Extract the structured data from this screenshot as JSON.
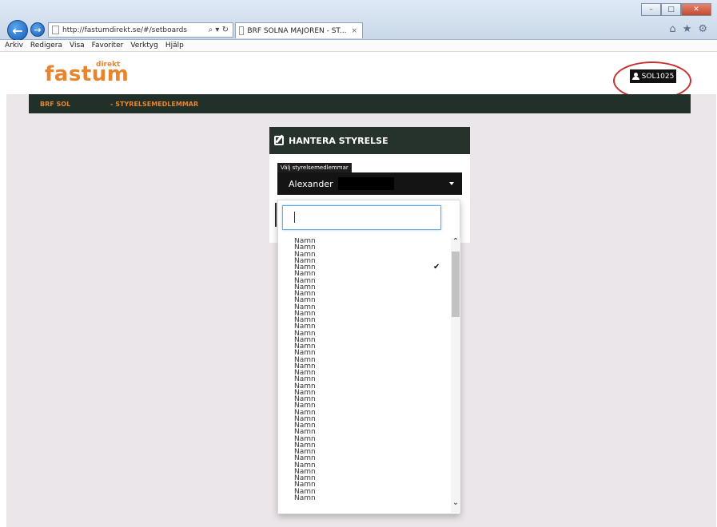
{
  "browser": {
    "url": "http://fastumdirekt.se/#/setboards",
    "tab_title": "BRF SOLNA MAJOREN - ST...",
    "tab_close": "×",
    "addr_tools": "⌕ ▾ ↻",
    "menu": [
      "Arkiv",
      "Redigera",
      "Visa",
      "Favoriter",
      "Verktyg",
      "Hjälp"
    ],
    "window_buttons": {
      "min": "–",
      "max": "□",
      "close": "✕"
    },
    "icons": {
      "home": "⌂",
      "star": "★",
      "gear": "⚙"
    }
  },
  "header": {
    "logo_text": "fastum",
    "logo_sup": "direkt",
    "user": "SOL1025"
  },
  "nav": {
    "brf": "BRF SOL",
    "section": "- STYRELSEMEDLEMMAR"
  },
  "card": {
    "title": "HANTERA STYRELSE",
    "field_label": "Välj styrelsemedlemmar",
    "selected": "Alexander"
  },
  "dropdown": {
    "search_value": "",
    "options": [
      "Namn",
      "Namn",
      "Namn",
      "Namn",
      "Namn",
      "Namn",
      "Namn",
      "Namn",
      "Namn",
      "Namn",
      "Namn",
      "Namn",
      "Namn",
      "Namn",
      "Namn",
      "Namn",
      "Namn",
      "Namn",
      "Namn",
      "Namn",
      "Namn",
      "Namn",
      "Namn",
      "Namn",
      "Namn",
      "Namn",
      "Namn",
      "Namn",
      "Namn",
      "Namn",
      "Namn",
      "Namn",
      "Namn",
      "Namn",
      "Namn",
      "Namn",
      "Namn",
      "Namn",
      "Namn",
      "Namn"
    ],
    "checked_index": 4,
    "check_glyph": "✔",
    "scroll_up": "⌃",
    "scroll_down": "⌄"
  }
}
